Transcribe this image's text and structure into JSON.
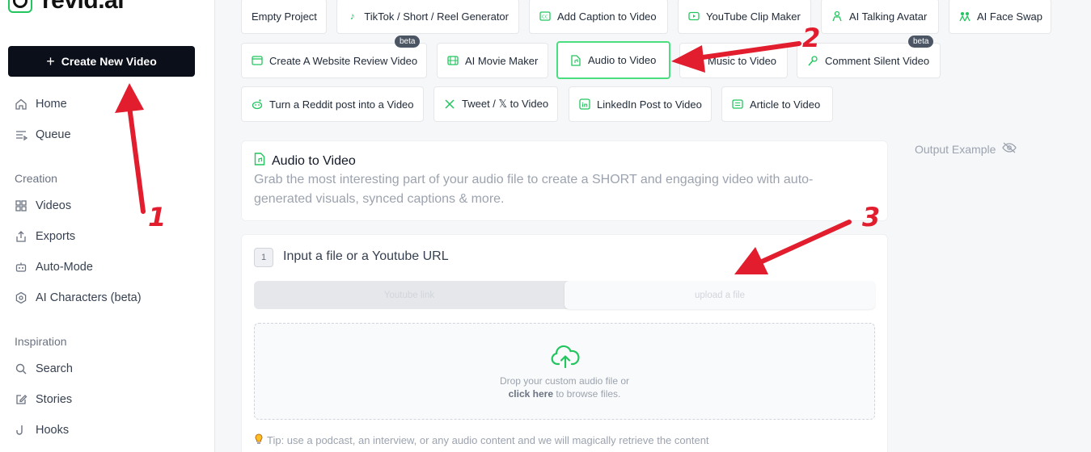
{
  "sidebar": {
    "logo_text": "revid.ai",
    "create_button": "Create New Video",
    "items_top": [
      {
        "label": "Home",
        "icon": "home-icon"
      },
      {
        "label": "Queue",
        "icon": "queue-icon"
      }
    ],
    "creation_title": "Creation",
    "creation_items": [
      {
        "label": "Videos",
        "icon": "grid-icon"
      },
      {
        "label": "Exports",
        "icon": "share-icon"
      },
      {
        "label": "Auto-Mode",
        "icon": "robot-icon"
      },
      {
        "label": "AI Characters (beta)",
        "icon": "cog-icon"
      }
    ],
    "inspiration_title": "Inspiration",
    "inspiration_items": [
      {
        "label": "Search",
        "icon": "search-icon"
      },
      {
        "label": "Stories",
        "icon": "edit-icon"
      },
      {
        "label": "Hooks",
        "icon": "hook-icon"
      }
    ]
  },
  "templates": {
    "row1": [
      "Empty Project",
      "TikTok / Short / Reel Generator",
      "Add Caption to Video",
      "YouTube Clip Maker",
      "AI Talking Avatar",
      "AI Face Swap"
    ],
    "row2": [
      "Create A Website Review Video",
      "AI Movie Maker",
      "Audio to Video",
      "Music to Video",
      "Comment Silent Video"
    ],
    "row3": [
      "Turn a Reddit post into a Video",
      "Tweet / 𝕏 to Video",
      "LinkedIn Post to Video",
      "Article to Video"
    ],
    "beta_label": "beta",
    "active": "Audio to Video"
  },
  "main": {
    "title": "Audio to Video",
    "description": "Grab the most interesting part of your audio file to create a SHORT and engaging video with auto-generated visuals, synced captions & more.",
    "step_number": "1",
    "step_title": "Input a file or a Youtube URL",
    "toggle": {
      "youtube": "Youtube link",
      "upload": "upload a file",
      "selected": "upload"
    },
    "drop": {
      "line1": "Drop your custom audio file or",
      "click": "click here",
      "line2_rest": " to browse files."
    },
    "tip": "Tip: use a podcast, an interview, or any audio content and we will magically retrieve the content",
    "output_example": "Output Example"
  },
  "annotations": {
    "one": "1",
    "two": "2",
    "three": "3",
    "color": "#e11d2e"
  },
  "colors": {
    "accent": "#22c55e",
    "primary_button": "#0b0f19"
  }
}
